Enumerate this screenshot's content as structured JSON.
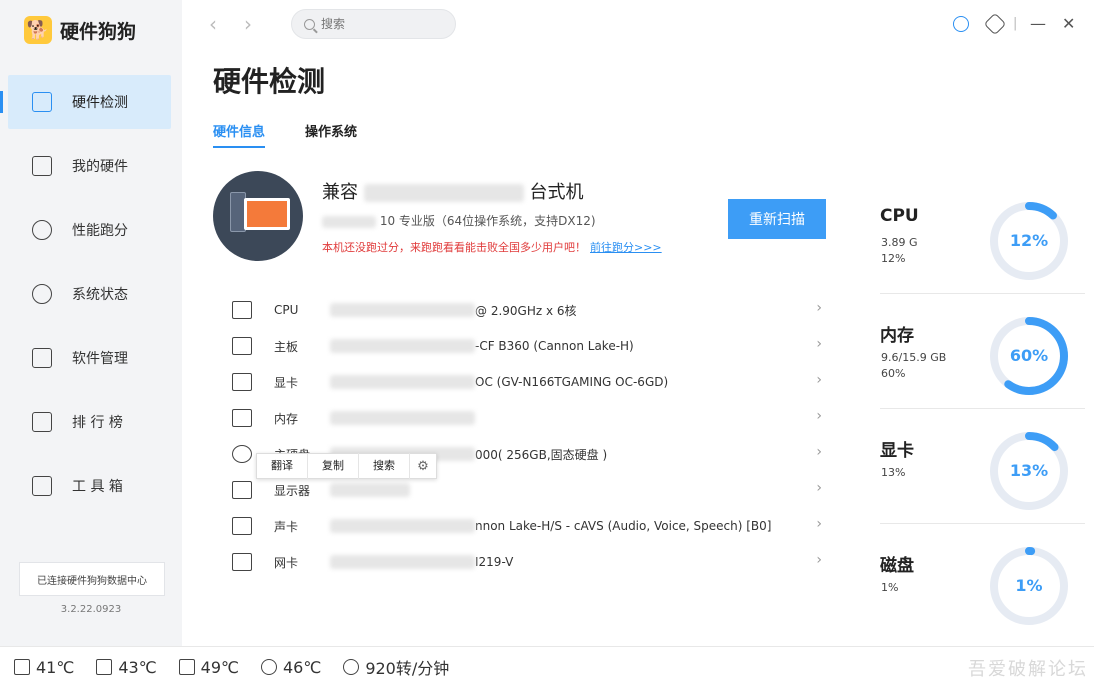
{
  "app": {
    "name": "硬件狗狗",
    "version": "3.2.22.0923",
    "connection_status": "已连接硬件狗狗数据中心"
  },
  "sidebar": {
    "items": [
      {
        "label": "硬件检测",
        "icon": "monitor-wave-icon",
        "active": true
      },
      {
        "label": "我的硬件",
        "icon": "board-icon",
        "active": false
      },
      {
        "label": "性能跑分",
        "icon": "gauge-icon",
        "active": false
      },
      {
        "label": "系统状态",
        "icon": "shield-wave-icon",
        "active": false
      },
      {
        "label": "软件管理",
        "icon": "apps-grid-icon",
        "active": false
      },
      {
        "label": "排 行 榜",
        "icon": "bar-chart-icon",
        "active": false
      },
      {
        "label": "工 具 箱",
        "icon": "toolbox-icon",
        "active": false
      }
    ]
  },
  "topbar": {
    "search_placeholder": "搜索",
    "back": "‹",
    "forward": "›",
    "minimize": "—",
    "close": "✕",
    "divider": "|"
  },
  "page": {
    "title": "硬件检测",
    "tabs": [
      {
        "label": "硬件信息",
        "active": true
      },
      {
        "label": "操作系统",
        "active": false
      }
    ]
  },
  "summary": {
    "name_prefix": "兼容",
    "name_suffix": "台式机",
    "os": "10 专业版（64位操作系统，支持DX12)",
    "promo": "本机还没跑过分，来跑跑看看能击败全国多少用户吧！",
    "promo_link": "前往跑分>>>",
    "rescan_label": "重新扫描"
  },
  "hardware": [
    {
      "label": "CPU",
      "value": "@ 2.90GHz x 6核",
      "icon": "cpu-icon"
    },
    {
      "label": "主板",
      "value": "-CF       B360 (Cannon Lake-H)",
      "icon": "motherboard-icon"
    },
    {
      "label": "显卡",
      "value": "OC (GV-N166TGAMING OC-6GD)",
      "icon": "gpu-icon"
    },
    {
      "label": "内存",
      "value": "",
      "icon": "memory-icon"
    },
    {
      "label": "主硬盘",
      "value": "000( 256GB,固态硬盘 )",
      "icon": "disk-icon"
    },
    {
      "label": "显示器",
      "value": "",
      "icon": "display-icon"
    },
    {
      "label": "声卡",
      "value": "nnon Lake-H/S - cAVS (Audio, Voice, Speech) [B0]",
      "icon": "speaker-icon"
    },
    {
      "label": "网卡",
      "value": "I219-V",
      "icon": "network-icon"
    }
  ],
  "context_menu": {
    "translate": "翻译",
    "copy": "复制",
    "search": "搜索"
  },
  "stats": [
    {
      "name": "CPU",
      "line1": "3.89 G",
      "line2": "12%",
      "percent": 12,
      "ring_label": "12%"
    },
    {
      "name": "内存",
      "line1": "9.6/15.9 GB",
      "line2": "60%",
      "percent": 60,
      "ring_label": "60%"
    },
    {
      "name": "显卡",
      "line1": "13%",
      "line2": "",
      "percent": 13,
      "ring_label": "13%"
    },
    {
      "name": "磁盘",
      "line1": "1%",
      "line2": "",
      "percent": 1,
      "ring_label": "1%"
    }
  ],
  "footer": {
    "temps": [
      {
        "value": "41℃",
        "icon": "cpu-temp-icon"
      },
      {
        "value": "43℃",
        "icon": "board-temp-icon"
      },
      {
        "value": "49℃",
        "icon": "gpu-temp-icon"
      },
      {
        "value": "46℃",
        "icon": "disk-temp-icon"
      },
      {
        "value": "920转/分钟",
        "icon": "fan-icon"
      }
    ],
    "watermark": "吾爱破解论坛"
  },
  "colors": {
    "accent": "#2a8ff2",
    "ring": "#3d9df6",
    "ring_track": "#e6ebf3",
    "promo": "#e03a3a"
  }
}
